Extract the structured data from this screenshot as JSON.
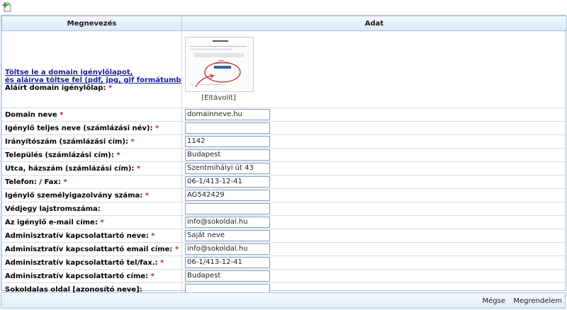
{
  "toolbar": {
    "new_icon": "new-document-plus-icon"
  },
  "table": {
    "header_name": "Megnevezés",
    "header_value": "Adat"
  },
  "upload": {
    "link_line1": "Töltse le a domain igénylőlapot,",
    "link_line2": "és aláírva töltse fel (pdf, jpg, gif formátumban) !",
    "label": "Aláírt domain igénylőlap:",
    "required": "*",
    "remove_label": "[Eltávolít]",
    "thumbnail_title": "domain igénylő lap"
  },
  "fields": [
    {
      "label": "Domain neve",
      "required": "*",
      "value": "domainneve.hu"
    },
    {
      "label": "Igénylő teljes neve (számlázási név):",
      "required": "*",
      "value": ""
    },
    {
      "label": "Irányítószám (számlázási cím):",
      "required": "*",
      "value": "1142"
    },
    {
      "label": "Település (számlázási cím):",
      "required": "*",
      "value": "Budapest"
    },
    {
      "label": "Utca, házszám (számlázási cím):",
      "required": "*",
      "value": "Szentmihályi út 43"
    },
    {
      "label": "Telefon: / Fax:",
      "required": "*",
      "value": "06-1/413-12-41"
    },
    {
      "label": "Igénylő személyigazolvány száma:",
      "required": "*",
      "value": "AG542429"
    },
    {
      "label": "Védjegy lajstromszáma:",
      "required": "",
      "value": ""
    },
    {
      "label": "Az igénylő e-mail címe:",
      "required": "*",
      "value": "info@sokoldal.hu"
    },
    {
      "label": "Adminisztratív kapcsolattartó neve:",
      "required": "*",
      "value": "Saját neve"
    },
    {
      "label": "Adminisztratív kapcsolattartó email címe:",
      "required": "*",
      "value": "info@sokoldal.hu"
    },
    {
      "label": "Adminisztratív kapcsolattartó tel/fax.:",
      "required": "*",
      "value": "06-1/413-12-41"
    },
    {
      "label": "Adminisztratív kapcsolattartó címe:",
      "required": "*",
      "value": "Budapest"
    },
    {
      "label": "Sokoldalas oldal [azonosító neve]:",
      "required": "",
      "value": ""
    }
  ],
  "actions": {
    "cancel_label": "Mégse",
    "order_label": "Megrendelem"
  },
  "colors": {
    "border": "#a9c4dd",
    "required": "#c0202a",
    "link": "#1a1aa6"
  }
}
